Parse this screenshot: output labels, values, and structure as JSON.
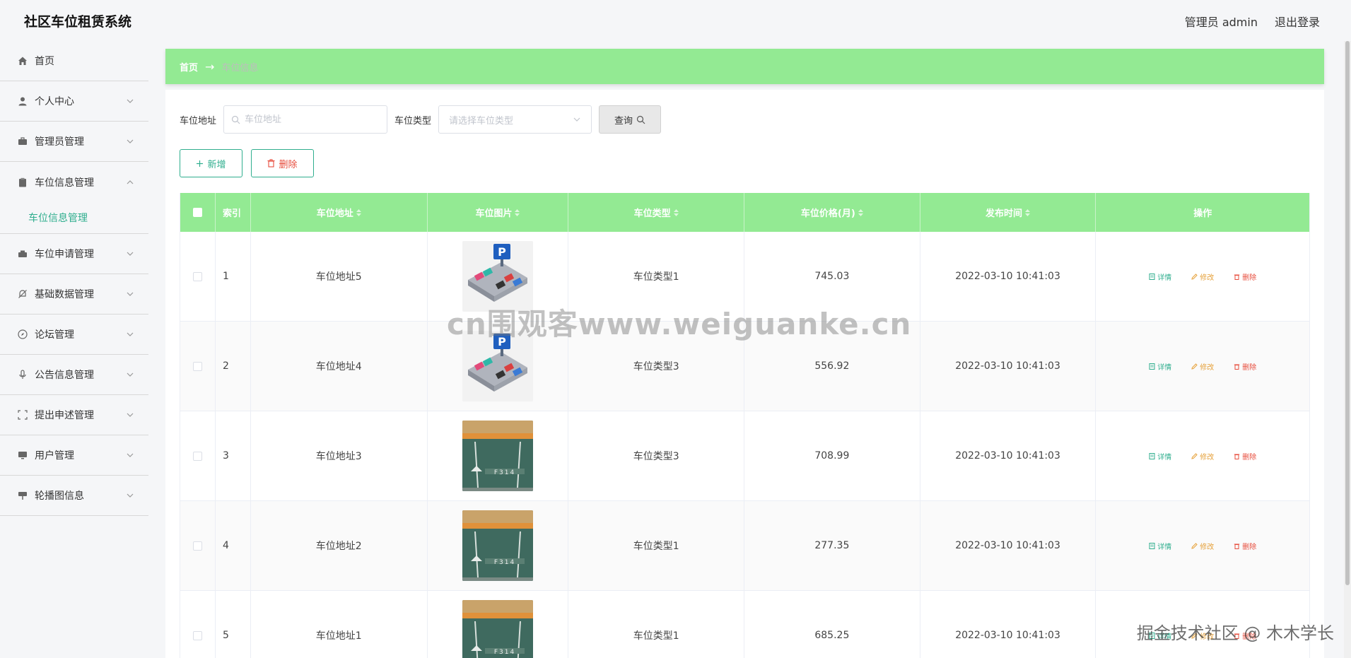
{
  "header": {
    "app_title": "社区车位租赁系统",
    "user_label": "管理员 admin",
    "logout_label": "退出登录"
  },
  "sidebar": {
    "items": [
      {
        "label": "首页",
        "icon": "home-icon"
      },
      {
        "label": "个人中心",
        "icon": "user-icon"
      },
      {
        "label": "管理员管理",
        "icon": "briefcase-icon"
      },
      {
        "label": "车位信息管理",
        "icon": "clipboard-icon",
        "open": true
      },
      {
        "label": "车位申请管理",
        "icon": "suitcase-icon"
      },
      {
        "label": "基础数据管理",
        "icon": "bell-off-icon"
      },
      {
        "label": "论坛管理",
        "icon": "compass-icon"
      },
      {
        "label": "公告信息管理",
        "icon": "microphone-icon"
      },
      {
        "label": "提出申述管理",
        "icon": "fullscreen-icon"
      },
      {
        "label": "用户管理",
        "icon": "monitor-icon"
      },
      {
        "label": "轮播图信息",
        "icon": "projector-icon"
      }
    ],
    "submenu_label": "车位信息管理"
  },
  "breadcrumb": {
    "home": "首页",
    "separator": "→",
    "current": "车位信息"
  },
  "search": {
    "address_label": "车位地址",
    "address_placeholder": "车位地址",
    "type_label": "车位类型",
    "type_placeholder": "请选择车位类型",
    "query_label": "查询"
  },
  "actions": {
    "add_label": "新增",
    "delete_label": "删除"
  },
  "table": {
    "headers": [
      "索引",
      "车位地址",
      "车位图片",
      "车位类型",
      "车位价格(月)",
      "发布时间",
      "操作"
    ],
    "rows": [
      {
        "index": "1",
        "address": "车位地址5",
        "type": "车位类型1",
        "price": "745.03",
        "time": "2022-03-10 10:41:03",
        "image": "parking-lot-illustration"
      },
      {
        "index": "2",
        "address": "车位地址4",
        "type": "车位类型3",
        "price": "556.92",
        "time": "2022-03-10 10:41:03",
        "image": "parking-lot-illustration"
      },
      {
        "index": "3",
        "address": "车位地址3",
        "type": "车位类型3",
        "price": "708.99",
        "time": "2022-03-10 10:41:03",
        "image": "garage-space-photo"
      },
      {
        "index": "4",
        "address": "车位地址2",
        "type": "车位类型1",
        "price": "277.35",
        "time": "2022-03-10 10:41:03",
        "image": "garage-space-photo"
      },
      {
        "index": "5",
        "address": "车位地址1",
        "type": "车位类型1",
        "price": "685.25",
        "time": "2022-03-10 10:41:03",
        "image": "garage-space-photo"
      }
    ],
    "op_detail": "详情",
    "op_edit": "修改",
    "op_delete": "删除"
  },
  "overlay": {
    "watermark": "cn围观客www.weiguanke.cn",
    "corner_mark": "掘金技术社区 @ 木木学长"
  },
  "colors": {
    "accent": "#93ea93",
    "link": "#2fae8e",
    "edit": "#e6a23c",
    "danger": "#e74c3c"
  }
}
